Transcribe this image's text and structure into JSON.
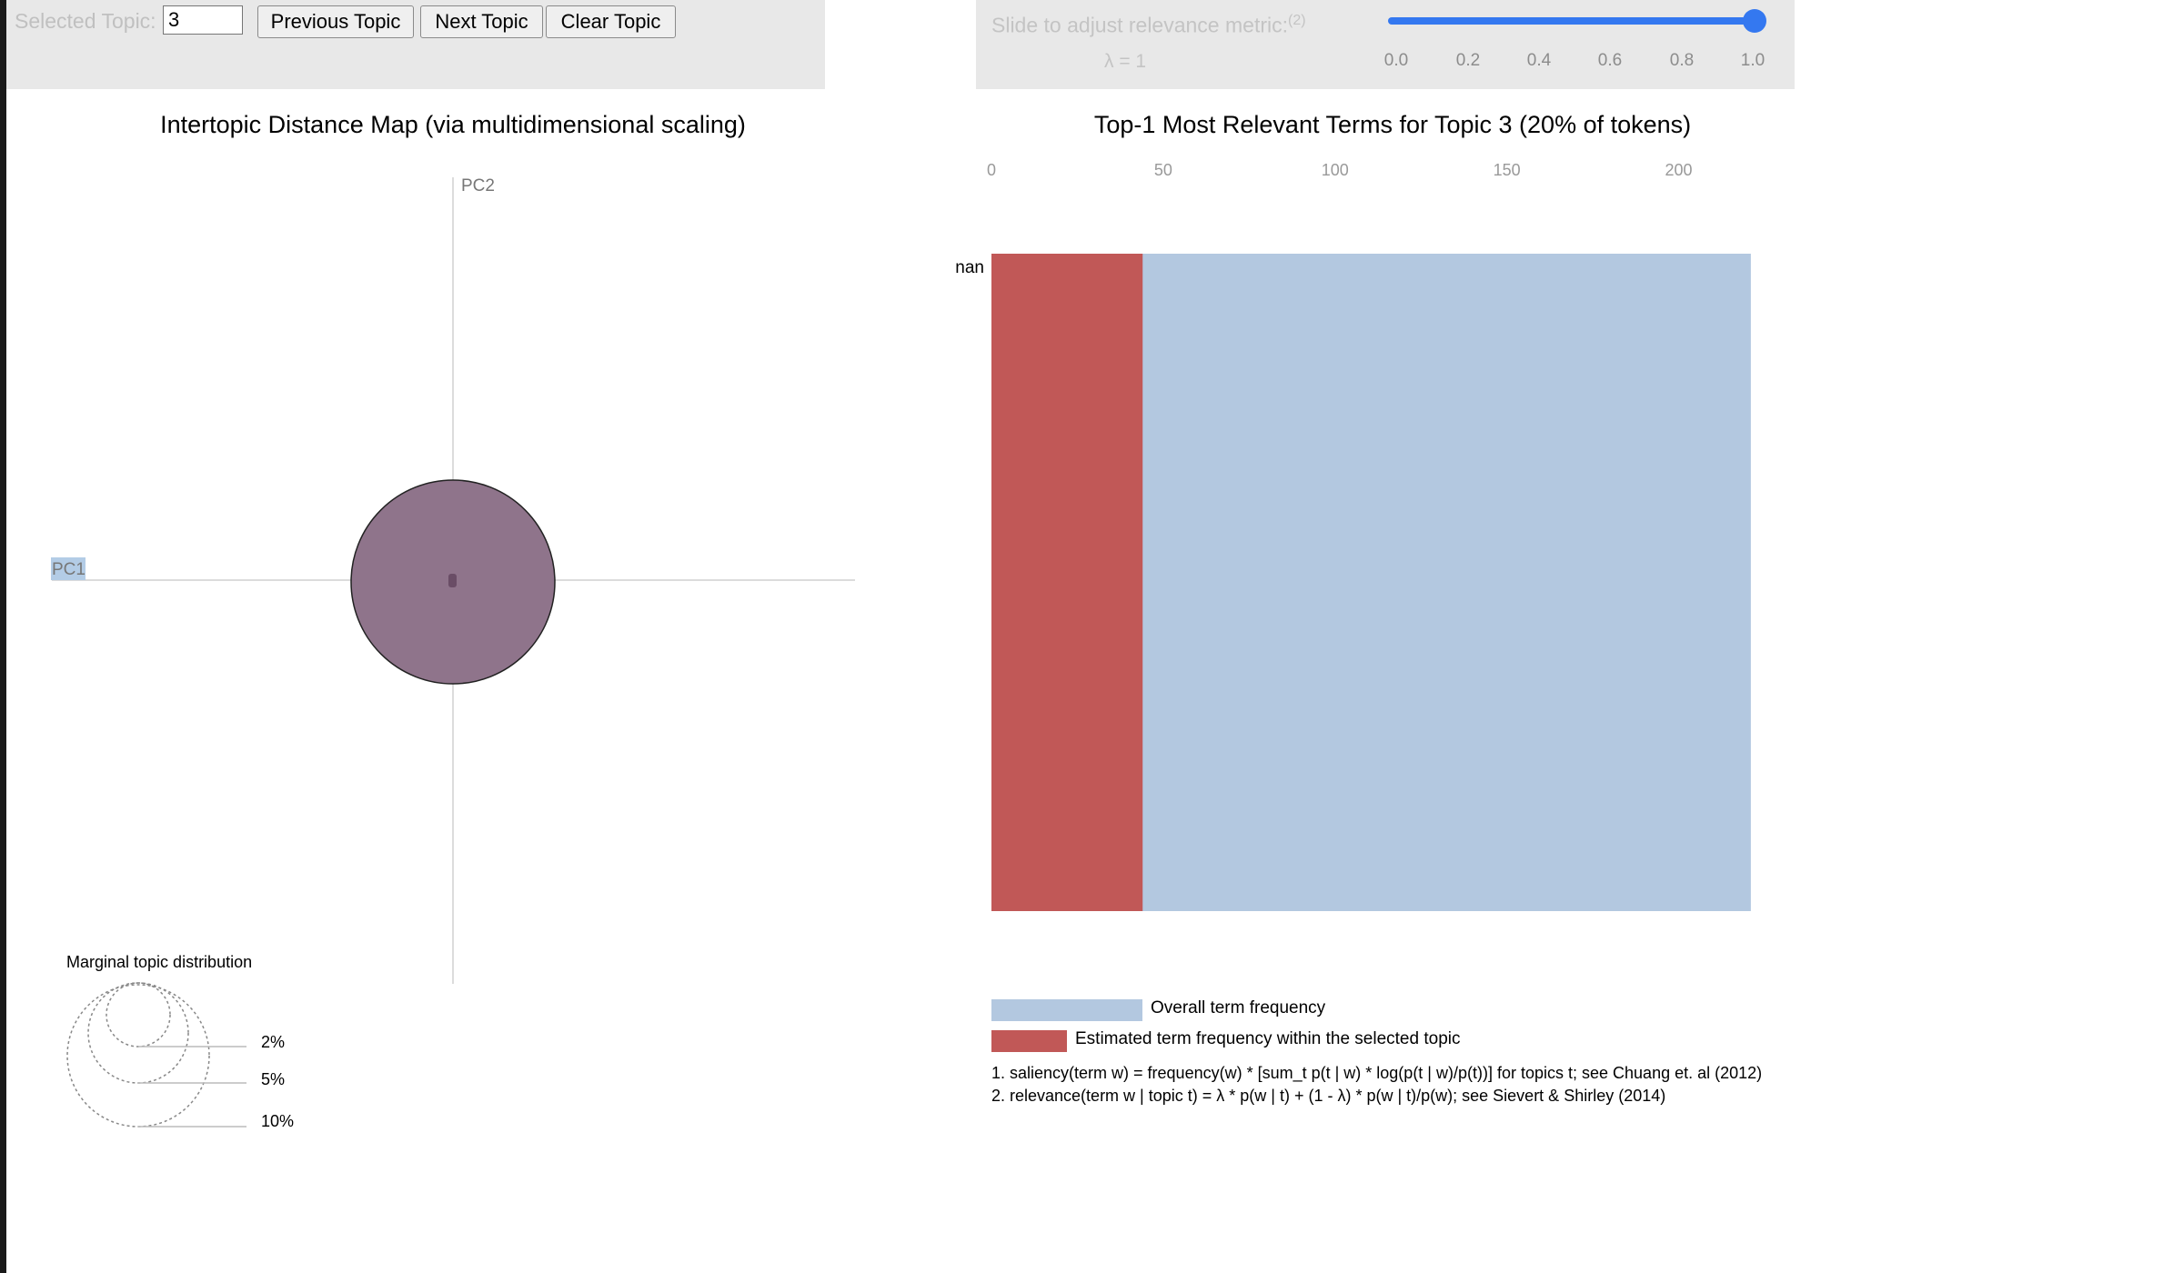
{
  "topic_controls": {
    "label": "Selected Topic:",
    "value": "3",
    "prev_label": "Previous Topic",
    "next_label": "Next Topic",
    "clear_label": "Clear Topic"
  },
  "lambda_controls": {
    "label": "Slide to adjust relevance metric:",
    "footnote": "(2)",
    "value_text": "λ = 1",
    "value": 1,
    "ticks": [
      "0.0",
      "0.2",
      "0.4",
      "0.6",
      "0.8",
      "1.0"
    ]
  },
  "mds": {
    "title": "Intertopic Distance Map (via multidimensional scaling)",
    "x_axis_label": "PC1",
    "y_axis_label": "PC2",
    "topic_color": "#8f748b",
    "marginal": {
      "title": "Marginal topic distribution",
      "labels": [
        "2%",
        "5%",
        "10%"
      ]
    }
  },
  "bars": {
    "title": "Top-1 Most Relevant Terms for Topic 3 (20% of tokens)",
    "overall_color": "#b3c8e0",
    "topic_color": "#c15857",
    "legend_overall": "Overall term frequency",
    "legend_topic": "Estimated term frequency within the selected topic",
    "note1": "1. saliency(term w) = frequency(w) * [sum_t p(t | w) * log(p(t | w)/p(t))] for topics t; see Chuang et. al (2012)",
    "note2": "2. relevance(term w | topic t) = λ * p(w | t) + (1 - λ) * p(w | t)/p(w); see Sievert & Shirley (2014)"
  },
  "chart_data": {
    "type": "bar",
    "orientation": "horizontal",
    "title": "Top-1 Most Relevant Terms for Topic 3 (20% of tokens)",
    "categories": [
      "nan"
    ],
    "x_ticks": [
      0,
      50,
      100,
      150,
      200
    ],
    "xlim": [
      0,
      225
    ],
    "series": [
      {
        "name": "Overall term frequency",
        "values": [
          221
        ]
      },
      {
        "name": "Estimated term frequency within the selected topic",
        "values": [
          44
        ]
      }
    ]
  }
}
